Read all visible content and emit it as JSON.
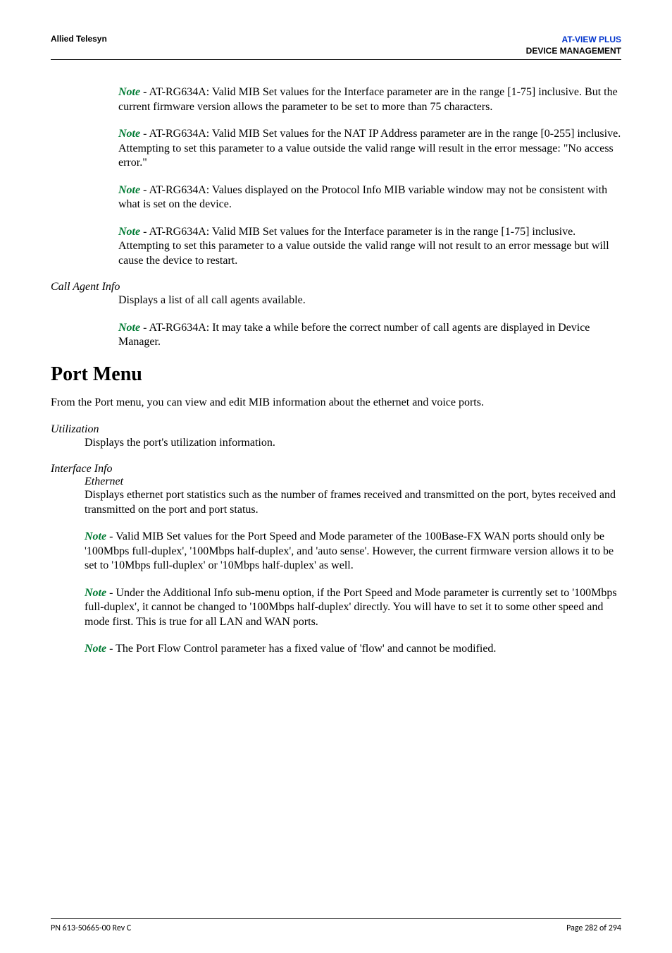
{
  "header": {
    "left": "Allied Telesyn",
    "right_line1": "AT-VIEW PLUS",
    "right_line2": "DEVICE MANAGEMENT"
  },
  "voip": {
    "note1": "- AT-RG634A: Valid MIB Set values for the Interface parameter are in the range [1-75] inclusive. But the current firmware version allows the parameter to be set to more than 75 characters.",
    "note2": "- AT-RG634A: Valid MIB Set values for the NAT IP Address parameter are in the range [0-255] inclusive. Attempting to set this parameter to a value outside the valid range will result in the error message: \"No access error.\"",
    "note3": "- AT-RG634A: Values displayed on the Protocol Info MIB variable window may not be consistent with what is set on the device.",
    "note4": "- AT-RG634A: Valid MIB Set values for the Interface parameter is in the range [1-75] inclusive. Attempting to set this parameter to a value outside the valid range will not result to an error message but will cause the device to restart."
  },
  "call_agent": {
    "label": "Call Agent Info",
    "desc": "Displays a list of all call agents available.",
    "note": "- AT-RG634A: It may take a while before the correct number of call agents are displayed in Device Manager."
  },
  "port_menu": {
    "heading": "Port Menu",
    "intro": "From the Port menu, you can view and edit MIB information about the ethernet and voice ports."
  },
  "utilization": {
    "label": "Utilization",
    "desc": "Displays the port's utilization information."
  },
  "interface_info": {
    "label": "Interface Info",
    "ethernet_label": "Ethernet",
    "ethernet_desc": "Displays ethernet port statistics such as the number of frames received and transmitted on the port, bytes received and transmitted on the port and port status.",
    "note1": "- Valid MIB Set values for the Port Speed and Mode parameter of the 100Base-FX WAN ports should only be '100Mbps full-duplex', '100Mbps half-duplex', and 'auto sense'. However, the current firmware version allows it to be set to '10Mbps full-duplex' or '10Mbps half-duplex' as well.",
    "note2": "- Under the Additional Info sub-menu option, if the Port Speed and Mode parameter is currently set to '100Mbps full-duplex', it cannot be changed to '100Mbps half-duplex' directly. You will have to set it to some other speed and mode first. This is true for all LAN and WAN ports.",
    "note3": "- The Port Flow Control parameter has a fixed value of 'flow' and cannot be modified."
  },
  "footer": {
    "left": "PN 613-50665-00 Rev C",
    "right": "Page 282 of 294"
  },
  "labels": {
    "note": "Note "
  }
}
